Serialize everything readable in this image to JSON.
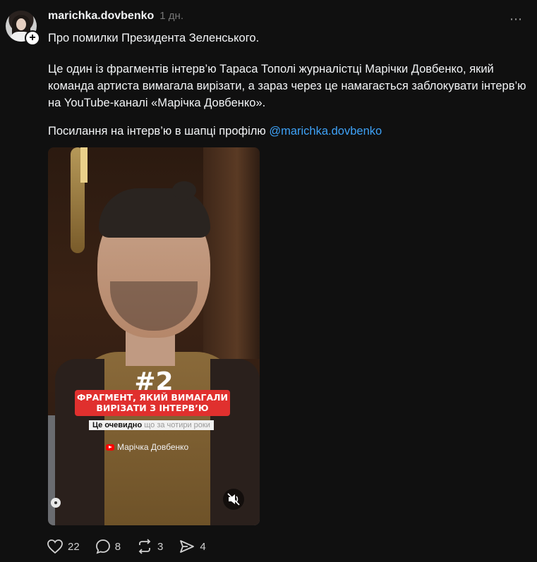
{
  "post": {
    "username": "marichka.dovbenko",
    "time": "1 дн.",
    "more_icon": "⋯",
    "paragraphs": {
      "p1": "Про помилки Президента Зеленського.",
      "p2": "Це один із фрагментів інтерв’ю Тараса Тополі журналістці Марічки Довбенко, який команда артиста вимагала вирізати, а зараз через це намагається заблокувати інтерв’ю на YouTube-каналі «Марічка Довбенко».",
      "p3_text": "Посилання на інтерв’ю в шапці профілю ",
      "p3_mention": "@marichka.dovbenko"
    }
  },
  "video": {
    "number": "#2",
    "banner_line1": "ФРАГМЕНТ, ЯКИЙ ВИМАГАЛИ",
    "banner_line2": "ВИРІЗАТИ З ІНТЕРВ’Ю",
    "subtitle_bold": "Це очевидно",
    "subtitle_rest": " що за чотири роки",
    "channel": "Марічка Довбенко"
  },
  "actions": {
    "likes": "22",
    "comments": "8",
    "reposts": "3",
    "shares": "4"
  },
  "colors": {
    "background": "#101010",
    "mention": "#3ea2f7",
    "banner": "#e0302e"
  }
}
